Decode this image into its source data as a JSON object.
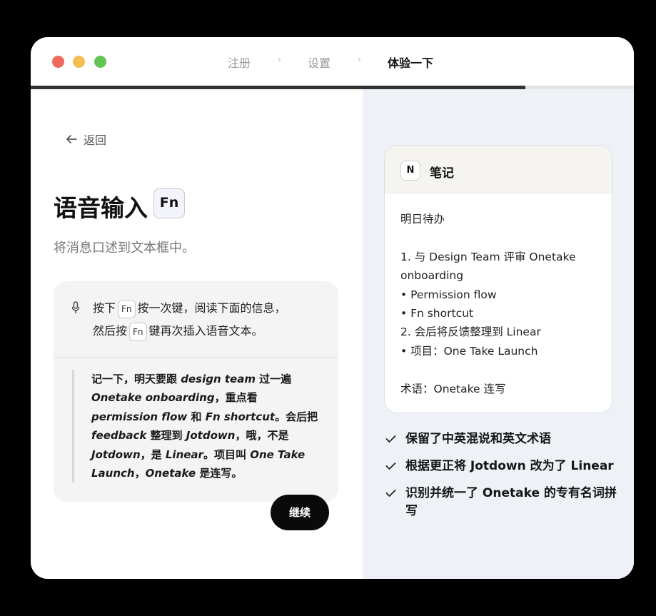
{
  "steps": [
    {
      "label": "注册",
      "active": false
    },
    {
      "label": "设置",
      "active": false
    },
    {
      "label": "体验一下",
      "active": true
    }
  ],
  "step_separator": "›",
  "progress": 0.82,
  "left": {
    "back_label": "返回",
    "title": "语音输入",
    "title_key": "Fn",
    "subtitle": "将消息口述到文本框中。",
    "instruction": {
      "line1_before": "按下",
      "key1": "Fn",
      "line1_after": "按一次键，阅读下面的信息，",
      "line2_before": "然后按",
      "key2": "Fn",
      "line2_after": "键再次插入语音文本。"
    },
    "quote": [
      {
        "t": "记一下，明天要跟 ",
        "i": false
      },
      {
        "t": "design team",
        "i": true
      },
      {
        "t": " 过一遍 ",
        "i": false
      },
      {
        "t": "Onetake onboarding",
        "i": true
      },
      {
        "t": "，重点看 ",
        "i": false
      },
      {
        "t": "permission flow",
        "i": true
      },
      {
        "t": " 和 ",
        "i": false
      },
      {
        "t": "Fn shortcut",
        "i": true
      },
      {
        "t": "。会后把 ",
        "i": false
      },
      {
        "t": "feedback",
        "i": true
      },
      {
        "t": " 整理到 ",
        "i": false
      },
      {
        "t": "Jotdown",
        "i": true
      },
      {
        "t": "，哦，不是 ",
        "i": false
      },
      {
        "t": "Jotdown",
        "i": true
      },
      {
        "t": "，是 ",
        "i": false
      },
      {
        "t": "Linear",
        "i": true
      },
      {
        "t": "。项目叫 ",
        "i": false
      },
      {
        "t": "One Take Launch",
        "i": true
      },
      {
        "t": "，",
        "i": false
      },
      {
        "t": "Onetake",
        "i": true
      },
      {
        "t": " 是连写。",
        "i": false
      }
    ],
    "continue_label": "继续"
  },
  "note": {
    "logo": "N",
    "title": "笔记",
    "lines": [
      "明日待办",
      "",
      "1. 与 Design Team 评审 Onetake onboarding",
      "• Permission flow",
      "• Fn shortcut",
      "2. 会后将反馈整理到 Linear",
      "• 项目：One Take Launch",
      "",
      "术语：Onetake 连写"
    ]
  },
  "checks": [
    "保留了中英混说和英文术语",
    "根据更正将 Jotdown 改为了 Linear",
    "识别并统一了 Onetake 的专有名词拼写"
  ],
  "icons": {
    "back": "arrow-left-icon",
    "mic": "microphone-icon",
    "check": "checkmark-icon"
  },
  "colors": {
    "traffic_red": "#ee6a5e",
    "traffic_yellow": "#f5bd4f",
    "traffic_green": "#61c454",
    "right_panel_bg": "#eef2f6",
    "primary_button": "#0a0a0a"
  }
}
